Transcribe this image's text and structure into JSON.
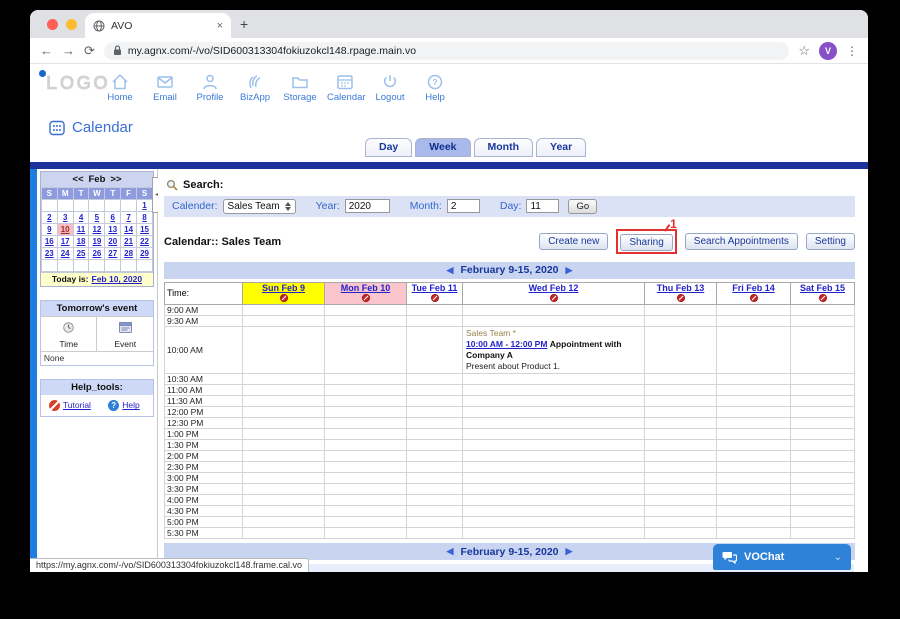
{
  "browser": {
    "tab_title": "AVO",
    "new_tab": "+",
    "close_tab": "×",
    "url": "my.agnx.com/-/vo/SID600313304fokiuzokcl148.rpage.main.vo",
    "avatar": "V",
    "status_url": "https://my.agnx.com/-/vo/SID600313304fokiuzokcl148.frame.cal.vo"
  },
  "header": {
    "logo": "LOGO",
    "nav": [
      {
        "icon": "home-icon",
        "label": "Home"
      },
      {
        "icon": "email-icon",
        "label": "Email"
      },
      {
        "icon": "profile-icon",
        "label": "Profile"
      },
      {
        "icon": "bizapp-icon",
        "label": "BizApp"
      },
      {
        "icon": "storage-icon",
        "label": "Storage"
      },
      {
        "icon": "calendar-icon",
        "label": "Calendar"
      },
      {
        "icon": "logout-icon",
        "label": "Logout"
      },
      {
        "icon": "help-icon",
        "label": "Help"
      }
    ],
    "page_title": "Calendar"
  },
  "view_tabs": {
    "items": [
      {
        "label": "Day",
        "active": false
      },
      {
        "label": "Week",
        "active": true
      },
      {
        "label": "Month",
        "active": false
      },
      {
        "label": "Year",
        "active": false
      }
    ]
  },
  "sidebar": {
    "mini_calendar": {
      "prev": "<<",
      "month": "Feb",
      "next": ">>",
      "day_headers": [
        "S",
        "M",
        "T",
        "W",
        "T",
        "F",
        "S"
      ],
      "weeks": [
        [
          "",
          "",
          "",
          "",
          "",
          "",
          "1"
        ],
        [
          "2",
          "3",
          "4",
          "5",
          "6",
          "7",
          "8"
        ],
        [
          "9",
          "10",
          "11",
          "12",
          "13",
          "14",
          "15"
        ],
        [
          "16",
          "17",
          "18",
          "19",
          "20",
          "21",
          "22"
        ],
        [
          "23",
          "24",
          "25",
          "26",
          "27",
          "28",
          "29"
        ],
        [
          "",
          "",
          "",
          "",
          "",
          "",
          ""
        ]
      ],
      "selected_date": "10",
      "today_label": "Today is:",
      "today_link": "Feb 10, 2020"
    },
    "tomorrow": {
      "title": "Tomorrow's event",
      "columns": [
        "Time",
        "Event"
      ],
      "value": "None"
    },
    "help_tools": {
      "title": "Help_tools:",
      "links": [
        "Tutorial",
        "Help"
      ]
    }
  },
  "search": {
    "title": "Search:",
    "calendar_label": "Calender:",
    "calendar_value": "Sales Team",
    "year_label": "Year:",
    "year_value": "2020",
    "month_label": "Month:",
    "month_value": "2",
    "day_label": "Day:",
    "day_value": "11",
    "go": "Go"
  },
  "toolbar": {
    "title": "Calendar:: Sales Team",
    "buttons": [
      "Create new",
      "Sharing",
      "Search Appointments",
      "Setting"
    ],
    "annotation": "1"
  },
  "week_view": {
    "nav_label": "February 9-15, 2020",
    "prev_arrow": "◀",
    "next_arrow": "▶",
    "time_header": "Time:",
    "days": [
      {
        "label": "Sun Feb 9",
        "bg": "#ffff00"
      },
      {
        "label": "Mon Feb 10",
        "bg": "#fac5cd"
      },
      {
        "label": "Tue Feb 11",
        "bg": ""
      },
      {
        "label": "Wed Feb 12",
        "bg": ""
      },
      {
        "label": "Thu Feb 13",
        "bg": ""
      },
      {
        "label": "Fri Feb 14",
        "bg": ""
      },
      {
        "label": "Sat Feb 15",
        "bg": ""
      }
    ],
    "times": [
      "9:00 AM",
      "9:30 AM",
      "10:00 AM",
      "10:30 AM",
      "11:00 AM",
      "11:30 AM",
      "12:00 PM",
      "12:30 PM",
      "1:00 PM",
      "1:30 PM",
      "2:00 PM",
      "2:30 PM",
      "3:00 PM",
      "3:30 PM",
      "4:00 PM",
      "4:30 PM",
      "5:00 PM",
      "5:30 PM"
    ],
    "event": {
      "day": "Wed Feb 12",
      "day_index": 3,
      "start_time": "10:00 AM",
      "span_times": [
        "10:30 AM",
        "11:00 AM",
        "11:30 AM"
      ],
      "calendar_name": "Sales Team *",
      "time_range": "10:00 AM - 12:00 PM",
      "title": "Appointment with Company A",
      "description": "Present about Product 1."
    }
  },
  "vochat": {
    "label": "VOChat"
  },
  "colors": {
    "navy_strip": "#1c339e",
    "side_strip": "#1e7de0",
    "lavender_bar": "#c9d4f1",
    "link_blue": "#2222cc",
    "event_bg": "#ffffcc",
    "sunday_bg": "#ffff00",
    "monday_bg": "#fac5cd",
    "annotation_red": "#e53030",
    "vochat_blue": "#2e82d8"
  }
}
